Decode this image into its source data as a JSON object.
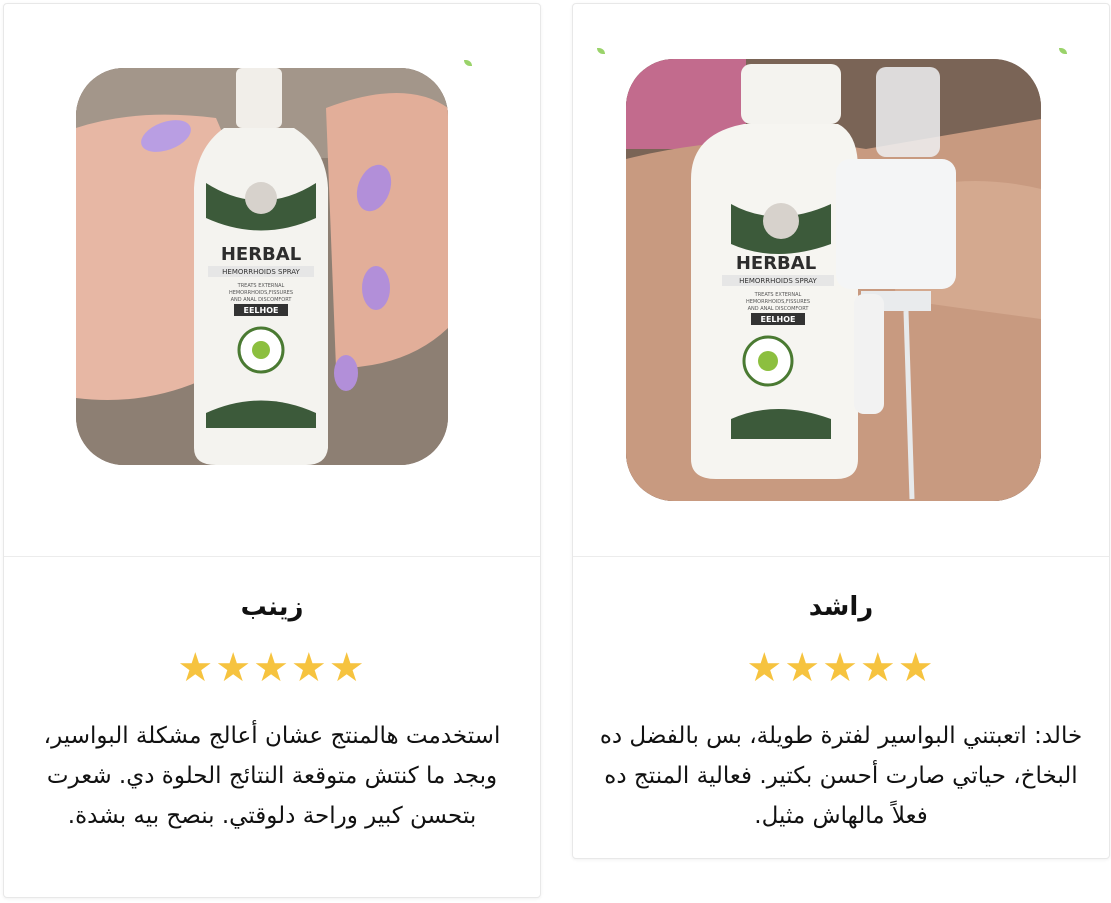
{
  "reviews": [
    {
      "name": "زينب",
      "rating": 5,
      "stars": "★★★★★",
      "text": "استخدمت هالمنتج عشان أعالج مشكلة البواسير، وبجد ما كنتش متوقعة النتائج الحلوة دي. شعرت بتحسن كبير وراحة دلوقتي. بنصح بيه بشدة.",
      "photo": {
        "product_name": "HERBAL",
        "product_subtitle": "HEMORRHOIDS SPRAY",
        "product_claim_1": "TREATS EXTERNAL",
        "product_claim_2": "HEMORRHOIDS,FISSURES",
        "product_claim_3": "AND ANAL DISCOMFORT",
        "brand": "EELHOE"
      }
    },
    {
      "name": "راشد",
      "rating": 5,
      "stars": "★★★★★",
      "text": "خالد: اتعبتني البواسير لفترة طويلة، بس بالفضل ده البخاخ، حياتي صارت أحسن بكتير. فعالية المنتج ده فعلاً مالهاش مثيل.",
      "photo": {
        "product_name": "HERBAL",
        "product_subtitle": "HEMORRHOIDS SPRAY",
        "product_claim_1": "TREATS EXTERNAL",
        "product_claim_2": "HEMORRHOIDS,FISSURES",
        "product_claim_3": "AND ANAL DISCOMFORT",
        "brand": "EELHOE"
      }
    }
  ],
  "colors": {
    "star": "#f6c33f",
    "text": "#111111",
    "border": "#e8e8e8",
    "leaf_accent": "#9ad36a"
  }
}
